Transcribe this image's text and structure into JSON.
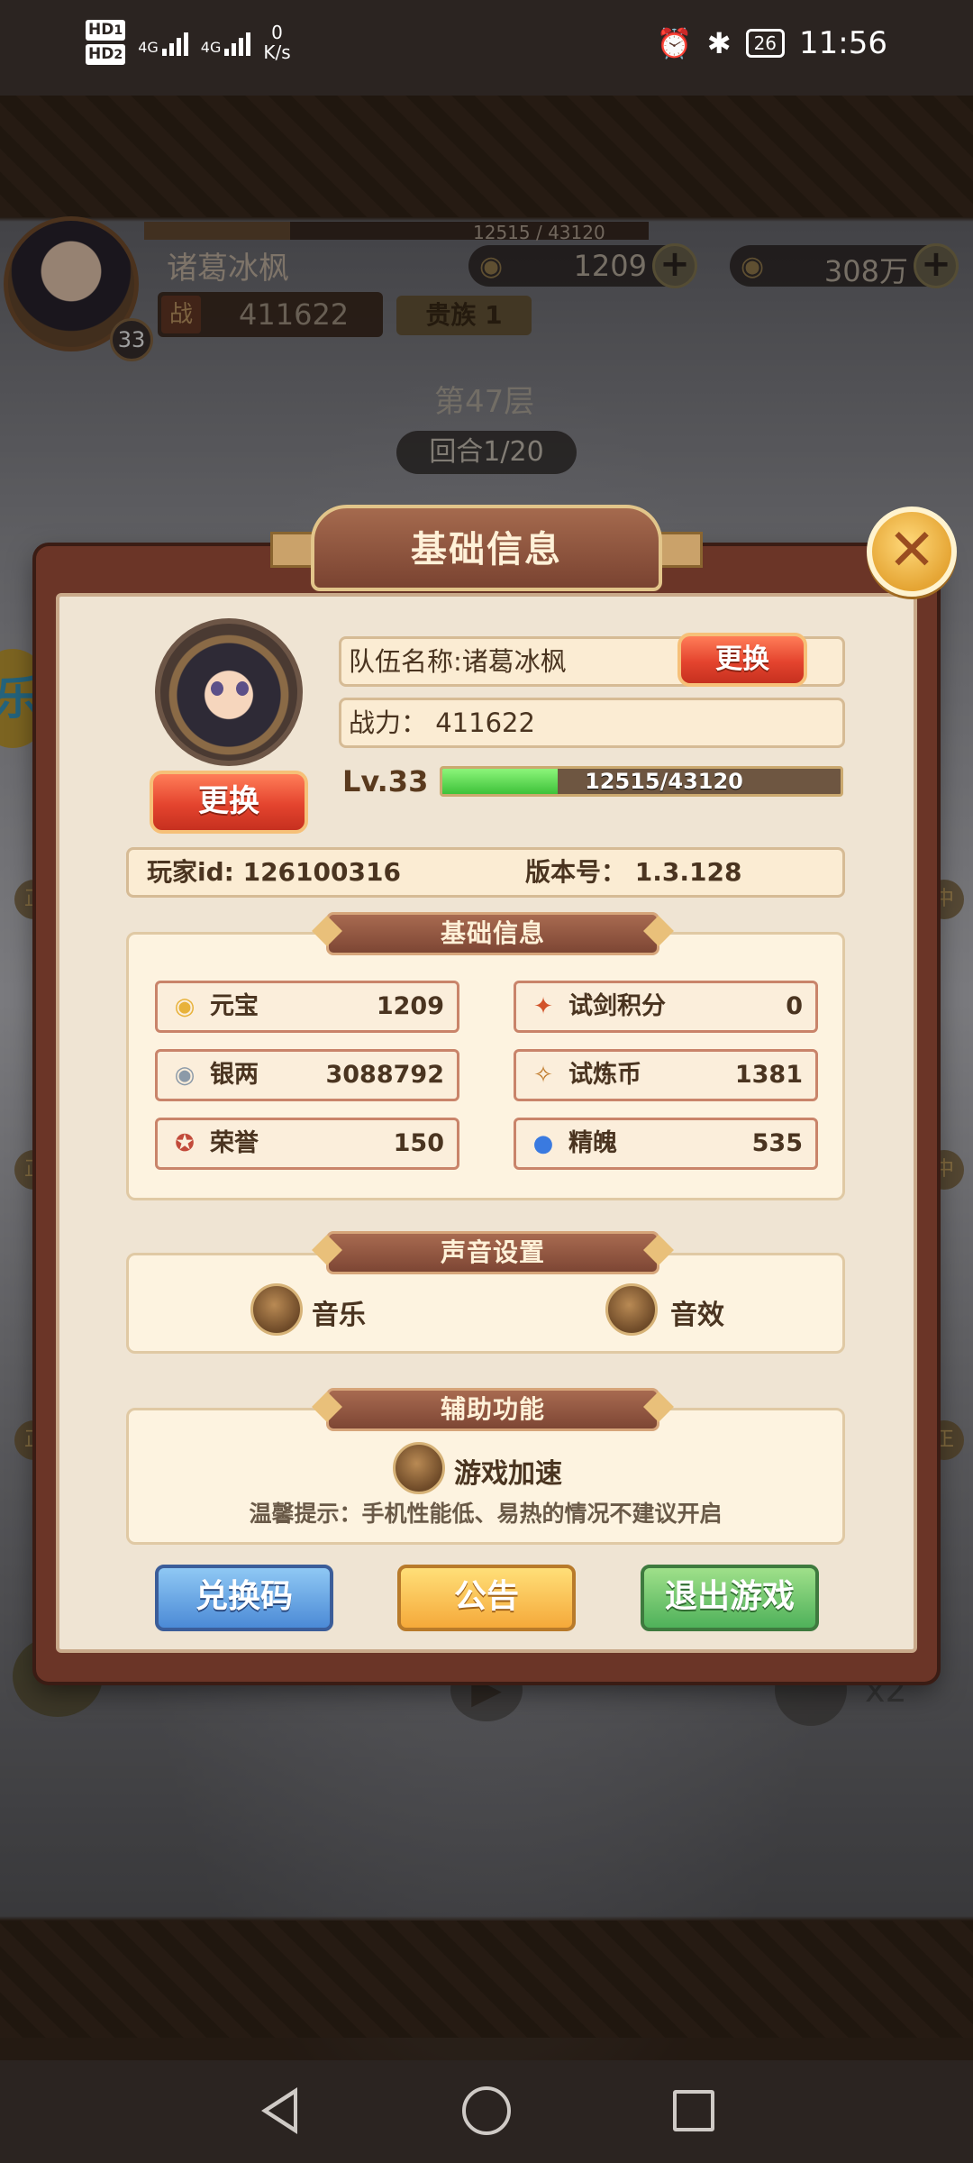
{
  "status_bar": {
    "hd1": "HD",
    "hd1_sub": "1",
    "hd2": "HD",
    "hd2_sub": "2",
    "net1": "4G",
    "net2": "4G",
    "speed_value": "0",
    "speed_unit": "K/s",
    "battery": "26",
    "time": "11:56",
    "icons": [
      "alarm-icon",
      "bluetooth-icon",
      "battery-icon"
    ]
  },
  "hud": {
    "player_name": "诸葛冰枫",
    "level": "33",
    "exp_text": "12515 / 43120",
    "exp_fraction": 0.29,
    "gold": "1209",
    "silver": "308万",
    "power_tag": "战",
    "power": "411622",
    "vip": "贵族 1",
    "floor": "第47层",
    "round": "回合1/20"
  },
  "dialog": {
    "title": "基础信息",
    "close_icon": "close-icon",
    "team_name": "队伍名称:诸葛冰枫",
    "change_label": "更换",
    "avatar_change_label": "更换",
    "power_text": "战力：  411622",
    "level_label": "Lv.33",
    "exp_text": "12515/43120",
    "exp_fraction": 0.29,
    "player_id": "玩家id: 126100316",
    "version": "版本号：  1.3.128",
    "basic_section": "基础信息",
    "resources": [
      {
        "icon": "gold-ingot-icon",
        "glyph": "◉",
        "color": "#e8b23a",
        "name": "元宝",
        "value": "1209"
      },
      {
        "icon": "sword-trial-icon",
        "glyph": "✦",
        "color": "#d2532a",
        "name": "试剑积分",
        "value": "0"
      },
      {
        "icon": "silver-ingot-icon",
        "glyph": "◉",
        "color": "#8c9aa8",
        "name": "银两",
        "value": "3088792"
      },
      {
        "icon": "trial-coin-icon",
        "glyph": "✧",
        "color": "#c07a2a",
        "name": "试炼币",
        "value": "1381"
      },
      {
        "icon": "honor-icon",
        "glyph": "✪",
        "color": "#c24a3a",
        "name": "荣誉",
        "value": "150"
      },
      {
        "icon": "soul-icon",
        "glyph": "●",
        "color": "#3a7ae0",
        "name": "精魄",
        "value": "535"
      }
    ],
    "sound_section": "声音设置",
    "music_label": "音乐",
    "sfx_label": "音效",
    "assist_section": "辅助功能",
    "speedup_label": "游戏加速",
    "hint": "温馨提示：手机性能低、易热的情况不建议开启",
    "redeem_label": "兑换码",
    "notice_label": "公告",
    "exit_label": "退出游戏"
  },
  "side": {
    "left_tag_1": "正",
    "left_tag_2": "正",
    "left_tag_3": "正",
    "right_tag_1": "中",
    "right_tag_2": "中",
    "right_tag_3": "正",
    "left_badge": "乐",
    "speed_multiplier": "x2"
  }
}
